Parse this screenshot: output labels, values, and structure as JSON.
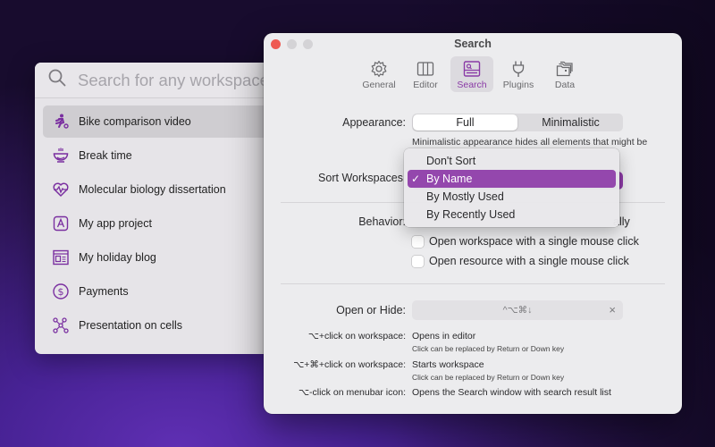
{
  "workspace_panel": {
    "search_placeholder": "Search for any workspace",
    "items": [
      {
        "label": "Bike comparison video",
        "icon": "cyclist-icon",
        "selected": true
      },
      {
        "label": "Break time",
        "icon": "hot-bowl-icon",
        "selected": false
      },
      {
        "label": "Molecular biology dissertation",
        "icon": "heart-pulse-icon",
        "selected": false
      },
      {
        "label": "My app project",
        "icon": "app-letter-a-icon",
        "selected": false
      },
      {
        "label": "My holiday blog",
        "icon": "blog-layout-icon",
        "selected": false
      },
      {
        "label": "Payments",
        "icon": "dollar-circle-icon",
        "selected": false
      },
      {
        "label": "Presentation on cells",
        "icon": "molecule-icon",
        "selected": false
      }
    ]
  },
  "window": {
    "title": "Search",
    "tabs": [
      {
        "label": "General",
        "icon": "gear-icon",
        "active": false
      },
      {
        "label": "Editor",
        "icon": "columns-icon",
        "active": false
      },
      {
        "label": "Search",
        "icon": "search-window-icon",
        "active": true
      },
      {
        "label": "Plugins",
        "icon": "plug-icon",
        "active": false
      },
      {
        "label": "Data",
        "icon": "folders-icon",
        "active": false
      }
    ],
    "appearance": {
      "label": "Appearance:",
      "options": [
        "Full",
        "Minimalistic"
      ],
      "selected": "Full",
      "hint": "Minimalistic appearance hides all elements that might be"
    },
    "sort": {
      "label": "Sort Workspaces",
      "options": [
        "Don't Sort",
        "By Name",
        "By Mostly Used",
        "By Recently Used"
      ],
      "selected": "By Name",
      "check_mark": "✓"
    },
    "behavior": {
      "label": "Behavior:",
      "partial_text": "ally",
      "checkboxes": [
        {
          "label": "Open workspace with a single mouse click",
          "checked": false
        },
        {
          "label": "Open resource with a single mouse click",
          "checked": false
        }
      ]
    },
    "open_hide": {
      "label": "Open or Hide:",
      "shortcut": "^⌥⌘↓",
      "clear": "×"
    },
    "shortcuts": [
      {
        "key": "⌥+click on workspace:",
        "value": "Opens in editor",
        "hint": "Click can be replaced by Return or Down key"
      },
      {
        "key": "⌥+⌘+click on workspace:",
        "value": "Starts workspace",
        "hint": "Click can be replaced by Return or Down key"
      },
      {
        "key": "⌥-click on menubar icon:",
        "value": "Opens the Search window with search result list",
        "hint": ""
      }
    ]
  },
  "colors": {
    "accent": "#8d3aa6",
    "menu_selection": "#9447ad",
    "icon_purple": "#7a2fa0"
  }
}
